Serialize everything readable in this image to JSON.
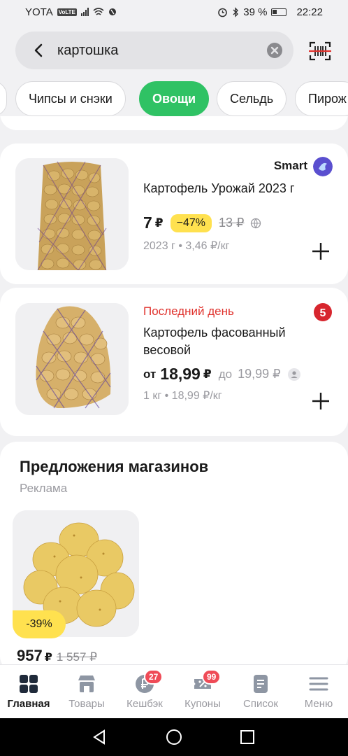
{
  "status_bar": {
    "carrier": "YOTA",
    "volte": "VoLTE",
    "battery": "39 %",
    "time": "22:22"
  },
  "search": {
    "value": "картошка"
  },
  "chips": [
    "Чипсы и снэки",
    "Овощи",
    "Сельдь",
    "Пирож"
  ],
  "active_chip": "Овощи",
  "products": [
    {
      "store": "Smart",
      "title": "Картофель Урожай 2023 г",
      "price": "7",
      "currency": "₽",
      "discount": "−47%",
      "old_price": "13 ₽",
      "meta": "2023 г • 3,46 ₽/кг"
    },
    {
      "label": "Последний день",
      "title": "Картофель фасованный весовой",
      "price_from": "от",
      "price": "18,99",
      "currency": "₽",
      "price_to": "до",
      "price_max": "19,99 ₽",
      "meta": "1 кг • 18,99 ₽/кг"
    }
  ],
  "offers": {
    "title": "Предложения магазинов",
    "ad_label": "Реклама",
    "item": {
      "discount": "-39%",
      "price": "957",
      "currency": "₽",
      "old_price": "1 557 ₽"
    }
  },
  "nav": [
    {
      "label": "Главная",
      "icon": "grid-icon",
      "badge": ""
    },
    {
      "label": "Товары",
      "icon": "shop-icon",
      "badge": ""
    },
    {
      "label": "Кешбэк",
      "icon": "ruble-coin-icon",
      "badge": "27"
    },
    {
      "label": "Купоны",
      "icon": "coupon-icon",
      "badge": "99"
    },
    {
      "label": "Список",
      "icon": "list-icon",
      "badge": ""
    },
    {
      "label": "Меню",
      "icon": "hamburger-icon",
      "badge": ""
    }
  ],
  "colors": {
    "accent_green": "#2fc264",
    "discount_yellow": "#ffe14f",
    "alert_red": "#e0332e",
    "badge_red": "#ef4b57"
  }
}
